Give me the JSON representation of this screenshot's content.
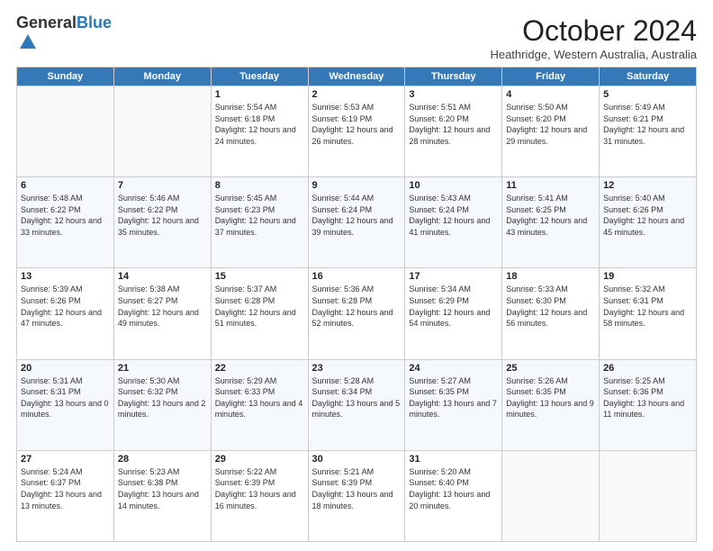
{
  "logo": {
    "general": "General",
    "blue": "Blue"
  },
  "header": {
    "month": "October 2024",
    "location": "Heathridge, Western Australia, Australia"
  },
  "days_of_week": [
    "Sunday",
    "Monday",
    "Tuesday",
    "Wednesday",
    "Thursday",
    "Friday",
    "Saturday"
  ],
  "weeks": [
    [
      {
        "day": "",
        "info": ""
      },
      {
        "day": "",
        "info": ""
      },
      {
        "day": "1",
        "info": "Sunrise: 5:54 AM\nSunset: 6:18 PM\nDaylight: 12 hours and 24 minutes."
      },
      {
        "day": "2",
        "info": "Sunrise: 5:53 AM\nSunset: 6:19 PM\nDaylight: 12 hours and 26 minutes."
      },
      {
        "day": "3",
        "info": "Sunrise: 5:51 AM\nSunset: 6:20 PM\nDaylight: 12 hours and 28 minutes."
      },
      {
        "day": "4",
        "info": "Sunrise: 5:50 AM\nSunset: 6:20 PM\nDaylight: 12 hours and 29 minutes."
      },
      {
        "day": "5",
        "info": "Sunrise: 5:49 AM\nSunset: 6:21 PM\nDaylight: 12 hours and 31 minutes."
      }
    ],
    [
      {
        "day": "6",
        "info": "Sunrise: 5:48 AM\nSunset: 6:22 PM\nDaylight: 12 hours and 33 minutes."
      },
      {
        "day": "7",
        "info": "Sunrise: 5:46 AM\nSunset: 6:22 PM\nDaylight: 12 hours and 35 minutes."
      },
      {
        "day": "8",
        "info": "Sunrise: 5:45 AM\nSunset: 6:23 PM\nDaylight: 12 hours and 37 minutes."
      },
      {
        "day": "9",
        "info": "Sunrise: 5:44 AM\nSunset: 6:24 PM\nDaylight: 12 hours and 39 minutes."
      },
      {
        "day": "10",
        "info": "Sunrise: 5:43 AM\nSunset: 6:24 PM\nDaylight: 12 hours and 41 minutes."
      },
      {
        "day": "11",
        "info": "Sunrise: 5:41 AM\nSunset: 6:25 PM\nDaylight: 12 hours and 43 minutes."
      },
      {
        "day": "12",
        "info": "Sunrise: 5:40 AM\nSunset: 6:26 PM\nDaylight: 12 hours and 45 minutes."
      }
    ],
    [
      {
        "day": "13",
        "info": "Sunrise: 5:39 AM\nSunset: 6:26 PM\nDaylight: 12 hours and 47 minutes."
      },
      {
        "day": "14",
        "info": "Sunrise: 5:38 AM\nSunset: 6:27 PM\nDaylight: 12 hours and 49 minutes."
      },
      {
        "day": "15",
        "info": "Sunrise: 5:37 AM\nSunset: 6:28 PM\nDaylight: 12 hours and 51 minutes."
      },
      {
        "day": "16",
        "info": "Sunrise: 5:36 AM\nSunset: 6:28 PM\nDaylight: 12 hours and 52 minutes."
      },
      {
        "day": "17",
        "info": "Sunrise: 5:34 AM\nSunset: 6:29 PM\nDaylight: 12 hours and 54 minutes."
      },
      {
        "day": "18",
        "info": "Sunrise: 5:33 AM\nSunset: 6:30 PM\nDaylight: 12 hours and 56 minutes."
      },
      {
        "day": "19",
        "info": "Sunrise: 5:32 AM\nSunset: 6:31 PM\nDaylight: 12 hours and 58 minutes."
      }
    ],
    [
      {
        "day": "20",
        "info": "Sunrise: 5:31 AM\nSunset: 6:31 PM\nDaylight: 13 hours and 0 minutes."
      },
      {
        "day": "21",
        "info": "Sunrise: 5:30 AM\nSunset: 6:32 PM\nDaylight: 13 hours and 2 minutes."
      },
      {
        "day": "22",
        "info": "Sunrise: 5:29 AM\nSunset: 6:33 PM\nDaylight: 13 hours and 4 minutes."
      },
      {
        "day": "23",
        "info": "Sunrise: 5:28 AM\nSunset: 6:34 PM\nDaylight: 13 hours and 5 minutes."
      },
      {
        "day": "24",
        "info": "Sunrise: 5:27 AM\nSunset: 6:35 PM\nDaylight: 13 hours and 7 minutes."
      },
      {
        "day": "25",
        "info": "Sunrise: 5:26 AM\nSunset: 6:35 PM\nDaylight: 13 hours and 9 minutes."
      },
      {
        "day": "26",
        "info": "Sunrise: 5:25 AM\nSunset: 6:36 PM\nDaylight: 13 hours and 11 minutes."
      }
    ],
    [
      {
        "day": "27",
        "info": "Sunrise: 5:24 AM\nSunset: 6:37 PM\nDaylight: 13 hours and 13 minutes."
      },
      {
        "day": "28",
        "info": "Sunrise: 5:23 AM\nSunset: 6:38 PM\nDaylight: 13 hours and 14 minutes."
      },
      {
        "day": "29",
        "info": "Sunrise: 5:22 AM\nSunset: 6:39 PM\nDaylight: 13 hours and 16 minutes."
      },
      {
        "day": "30",
        "info": "Sunrise: 5:21 AM\nSunset: 6:39 PM\nDaylight: 13 hours and 18 minutes."
      },
      {
        "day": "31",
        "info": "Sunrise: 5:20 AM\nSunset: 6:40 PM\nDaylight: 13 hours and 20 minutes."
      },
      {
        "day": "",
        "info": ""
      },
      {
        "day": "",
        "info": ""
      }
    ]
  ]
}
